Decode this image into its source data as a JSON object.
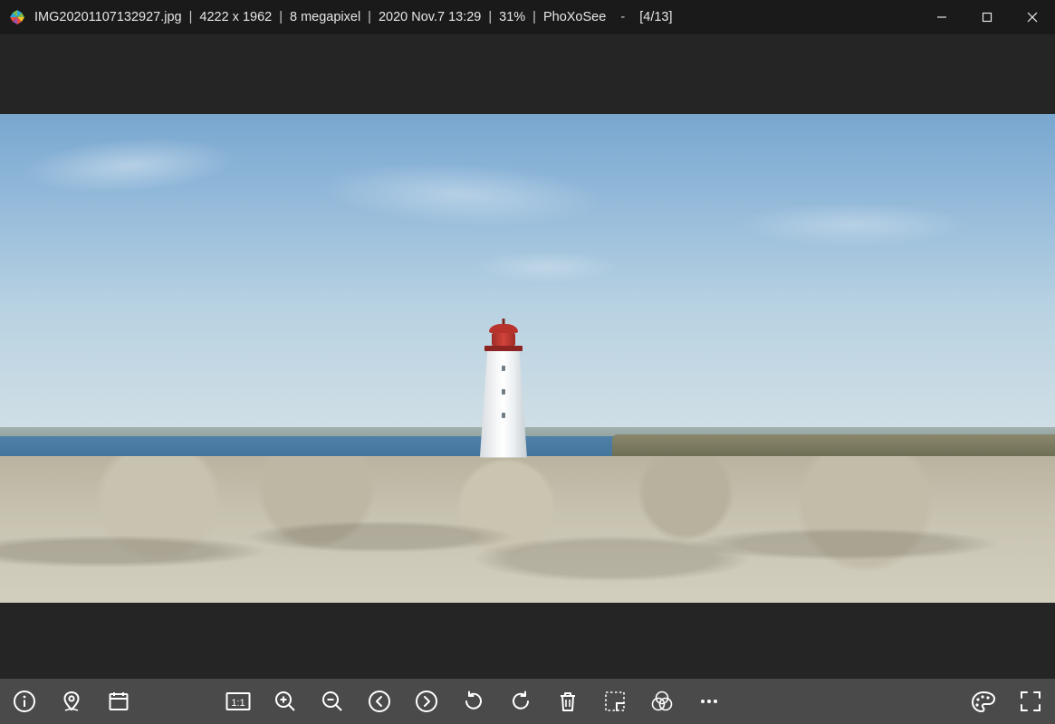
{
  "titlebar": {
    "filename": "IMG20201107132927.jpg",
    "dimensions": "4222 x 1962",
    "megapixel": "8 megapixel",
    "datetime": "2020 Nov.7 13:29",
    "zoom": "31%",
    "appname": "PhoXoSee",
    "position": "[4/13]",
    "separator": "|",
    "dash": "-"
  },
  "toolbar": {
    "info": "info",
    "location": "location",
    "datetime": "datetime",
    "actual_size": "1:1",
    "zoom_in": "zoom-in",
    "zoom_out": "zoom-out",
    "prev": "previous",
    "next": "next",
    "rotate_ccw": "rotate-ccw",
    "rotate_cw": "rotate-cw",
    "delete": "delete",
    "crop": "crop",
    "adjust": "adjust",
    "more": "more",
    "palette": "palette",
    "fullscreen": "fullscreen"
  }
}
